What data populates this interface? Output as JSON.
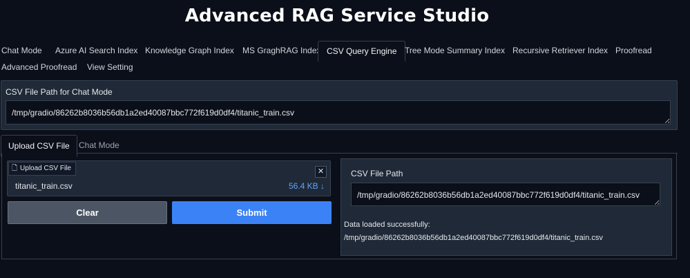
{
  "app": {
    "title": "Advanced RAG Service Studio"
  },
  "tabs": [
    {
      "label": "Chat Mode"
    },
    {
      "label": "Azure AI Search Index"
    },
    {
      "label": "Knowledge Graph Index"
    },
    {
      "label": "MS GraghRAG Index"
    },
    {
      "label": "CSV Query Engine",
      "active": true
    },
    {
      "label": "Tree Mode Summary Index"
    },
    {
      "label": "Recursive Retriever Index"
    },
    {
      "label": "Proofread"
    },
    {
      "label": "Advanced Proofread"
    },
    {
      "label": "View Setting"
    }
  ],
  "chat_path": {
    "label": "CSV File Path for Chat Mode",
    "value": "/tmp/gradio/86262b8036b56db1a2ed40087bbc772f619d0df4/titanic_train.csv"
  },
  "subtabs": [
    {
      "label": "Upload CSV File",
      "active": true
    },
    {
      "label": "Chat Mode"
    }
  ],
  "upload": {
    "chip_label": "Upload CSV File",
    "close_glyph": "✕",
    "file_name": "titanic_train.csv",
    "file_size": "56.4 KB ↓"
  },
  "buttons": {
    "clear": "Clear",
    "submit": "Submit"
  },
  "csv_path": {
    "label": "CSV File Path",
    "value": "/tmp/gradio/86262b8036b56db1a2ed40087bbc772f619d0df4/titanic_train.csv"
  },
  "status": {
    "line1": "Data loaded successfully:",
    "line2": "/tmp/gradio/86262b8036b56db1a2ed40087bbc772f619d0df4/titanic_train.csv"
  },
  "colors": {
    "accent": "#3b82f6",
    "background": "#0b0f19",
    "panel": "#1f2937"
  }
}
